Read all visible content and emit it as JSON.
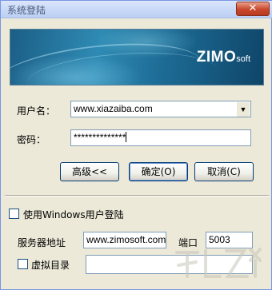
{
  "window": {
    "title": "系统登陆",
    "close_symbol": "✕"
  },
  "banner": {
    "logo_main": "ZIMO",
    "logo_sub": "soft"
  },
  "login": {
    "username_label": "用户名：",
    "username_value": "www.xiazaiba.com",
    "password_label": "密码：",
    "password_value": "**************"
  },
  "buttons": {
    "advanced": "高级<<",
    "ok": "确定(O)",
    "cancel": "取消(C)"
  },
  "advanced": {
    "windows_user_label": "使用Windows用户登陆",
    "server_label": "服务器地址",
    "server_value": "www.zimosoft.com",
    "port_label": "端口",
    "port_value": "5003",
    "virtual_dir_label": "虚拟目录",
    "virtual_dir_value": ""
  },
  "icons": {
    "dropdown": "chevron-down-icon"
  }
}
